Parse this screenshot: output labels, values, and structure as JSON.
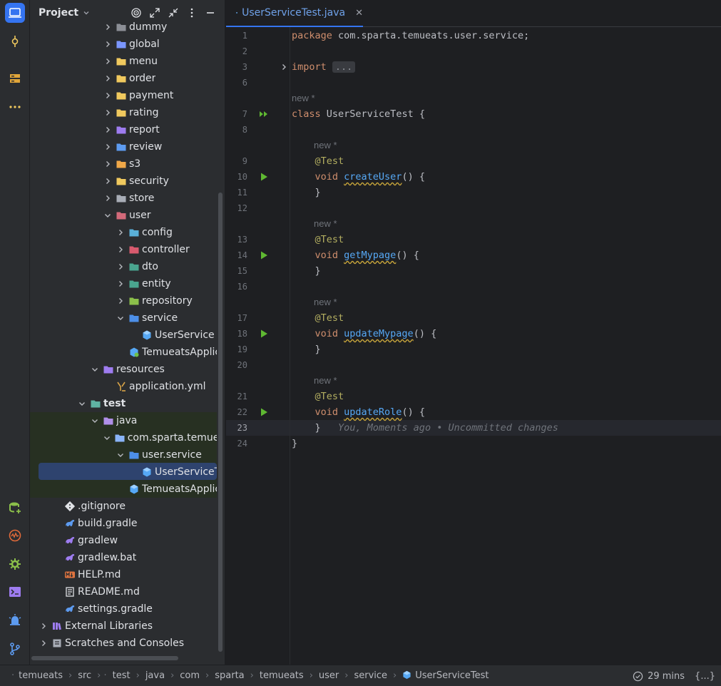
{
  "project_panel": {
    "title": "Project",
    "tree": [
      {
        "label": "dummy",
        "depth": 5,
        "expanded": false,
        "icon": "folder-package-icon",
        "color": "#8c8f96"
      },
      {
        "label": "global",
        "depth": 5,
        "expanded": false,
        "icon": "folder-global-icon",
        "color": "#7b96ff"
      },
      {
        "label": "menu",
        "depth": 5,
        "expanded": false,
        "icon": "folder-icon",
        "color": "#f0c95e"
      },
      {
        "label": "order",
        "depth": 5,
        "expanded": false,
        "icon": "folder-icon",
        "color": "#f0c95e"
      },
      {
        "label": "payment",
        "depth": 5,
        "expanded": false,
        "icon": "folder-icon",
        "color": "#f0c95e"
      },
      {
        "label": "rating",
        "depth": 5,
        "expanded": false,
        "icon": "folder-icon",
        "color": "#f0c95e"
      },
      {
        "label": "report",
        "depth": 5,
        "expanded": false,
        "icon": "folder-report-icon",
        "color": "#9e7cf0"
      },
      {
        "label": "review",
        "depth": 5,
        "expanded": false,
        "icon": "folder-review-icon",
        "color": "#5d9bf0"
      },
      {
        "label": "s3",
        "depth": 5,
        "expanded": false,
        "icon": "folder-cloud-icon",
        "color": "#f0a848"
      },
      {
        "label": "security",
        "depth": 5,
        "expanded": false,
        "icon": "folder-lock-icon",
        "color": "#f0c95e"
      },
      {
        "label": "store",
        "depth": 5,
        "expanded": false,
        "icon": "folder-store-icon",
        "color": "#a8adb6"
      },
      {
        "label": "user",
        "depth": 5,
        "expanded": true,
        "icon": "folder-user-icon",
        "color": "#d36a7a"
      },
      {
        "label": "config",
        "depth": 6,
        "expanded": false,
        "icon": "folder-config-icon",
        "color": "#5ab0d8"
      },
      {
        "label": "controller",
        "depth": 6,
        "expanded": false,
        "icon": "folder-controller-icon",
        "color": "#d85a6e"
      },
      {
        "label": "dto",
        "depth": 6,
        "expanded": false,
        "icon": "folder-dto-icon",
        "color": "#4aa58f"
      },
      {
        "label": "entity",
        "depth": 6,
        "expanded": false,
        "icon": "folder-entity-icon",
        "color": "#4aa58f"
      },
      {
        "label": "repository",
        "depth": 6,
        "expanded": false,
        "icon": "folder-repository-icon",
        "color": "#8bbf4a"
      },
      {
        "label": "service",
        "depth": 6,
        "expanded": true,
        "icon": "folder-service-icon",
        "color": "#4d8fe8"
      },
      {
        "label": "UserService",
        "depth": 8,
        "expanded": null,
        "icon": "java-class-icon",
        "color": "#56a8f5"
      },
      {
        "label": "TemueatsApplication",
        "depth": 7,
        "expanded": null,
        "icon": "spring-app-icon",
        "color": "#56a8f5"
      },
      {
        "label": "resources",
        "depth": 4,
        "expanded": true,
        "icon": "folder-resources-icon",
        "color": "#9e7cf0"
      },
      {
        "label": "application.yml",
        "depth": 6,
        "expanded": null,
        "icon": "yaml-file-icon",
        "color": "#d8a347"
      },
      {
        "label": "test",
        "depth": 3,
        "expanded": true,
        "icon": "folder-test-icon",
        "color": "#5fb3a3",
        "bold": true
      },
      {
        "label": "java",
        "depth": 4,
        "expanded": true,
        "icon": "folder-test-source-icon",
        "color": "#b08fe8"
      },
      {
        "label": "com.sparta.temueats",
        "depth": 5,
        "expanded": true,
        "icon": "folder-package-icon",
        "color": "#8ab4f8"
      },
      {
        "label": "user.service",
        "depth": 6,
        "expanded": true,
        "icon": "folder-service-icon",
        "color": "#4d8fe8"
      },
      {
        "label": "UserServiceTest",
        "depth": 8,
        "expanded": null,
        "icon": "java-class-icon",
        "color": "#56a8f5",
        "selected": true
      },
      {
        "label": "TemueatsApplicationTests",
        "depth": 7,
        "expanded": null,
        "icon": "java-class-icon",
        "color": "#56a8f5"
      },
      {
        "label": ".gitignore",
        "depth": 2,
        "expanded": null,
        "icon": "git-icon",
        "color": "#dfe1e5"
      },
      {
        "label": "build.gradle",
        "depth": 2,
        "expanded": null,
        "icon": "gradle-icon",
        "color": "#5d9bf0"
      },
      {
        "label": "gradlew",
        "depth": 2,
        "expanded": null,
        "icon": "gradle-icon",
        "color": "#9e7cf0"
      },
      {
        "label": "gradlew.bat",
        "depth": 2,
        "expanded": null,
        "icon": "gradle-icon",
        "color": "#9e7cf0"
      },
      {
        "label": "HELP.md",
        "depth": 2,
        "expanded": null,
        "icon": "markdown-icon",
        "color": "#e0743f"
      },
      {
        "label": "README.md",
        "depth": 2,
        "expanded": null,
        "icon": "readme-icon",
        "color": "#dfe1e5"
      },
      {
        "label": "settings.gradle",
        "depth": 2,
        "expanded": null,
        "icon": "gradle-icon",
        "color": "#5d9bf0"
      },
      {
        "label": "External Libraries",
        "depth": 0,
        "expanded": false,
        "icon": "library-icon",
        "color": "#9e7cf0"
      },
      {
        "label": "Scratches and Consoles",
        "depth": 0,
        "expanded": false,
        "icon": "scratches-icon",
        "color": "#a8adb6"
      }
    ]
  },
  "editor": {
    "tab_label": "UserServiceTest.java",
    "current_line": 23,
    "lines": [
      {
        "n": "1",
        "segments": [
          [
            "kw",
            "package "
          ],
          [
            "",
            "com.sparta.temueats.user.service;"
          ]
        ]
      },
      {
        "n": "2",
        "segments": []
      },
      {
        "n": "3",
        "segments": [
          [
            "kw",
            "import "
          ],
          [
            "fold",
            "..."
          ]
        ],
        "fold": true
      },
      {
        "n": "6",
        "segments": []
      },
      {
        "hint": "new *",
        "indent": 0
      },
      {
        "n": "7",
        "segments": [
          [
            "kw",
            "class "
          ],
          [
            "",
            "UserServiceTest "
          ],
          [
            "br",
            "{"
          ]
        ],
        "run": "double"
      },
      {
        "n": "8",
        "segments": []
      },
      {
        "hint": "new *",
        "indent": 1
      },
      {
        "n": "9",
        "segments": [
          [
            "ann",
            "    @Test"
          ]
        ]
      },
      {
        "n": "10",
        "segments": [
          [
            "kw",
            "    void "
          ],
          [
            "fn",
            "createUser"
          ],
          [
            "",
            "() "
          ],
          [
            "br",
            "{"
          ]
        ],
        "run": "single"
      },
      {
        "n": "11",
        "segments": [
          [
            "br",
            "    }"
          ]
        ]
      },
      {
        "n": "12",
        "segments": []
      },
      {
        "hint": "new *",
        "indent": 1
      },
      {
        "n": "13",
        "segments": [
          [
            "ann",
            "    @Test"
          ]
        ]
      },
      {
        "n": "14",
        "segments": [
          [
            "kw",
            "    void "
          ],
          [
            "fn",
            "getMypage"
          ],
          [
            "",
            "() "
          ],
          [
            "br",
            "{"
          ]
        ],
        "run": "single"
      },
      {
        "n": "15",
        "segments": [
          [
            "br",
            "    }"
          ]
        ]
      },
      {
        "n": "16",
        "segments": []
      },
      {
        "hint": "new *",
        "indent": 1
      },
      {
        "n": "17",
        "segments": [
          [
            "ann",
            "    @Test"
          ]
        ]
      },
      {
        "n": "18",
        "segments": [
          [
            "kw",
            "    void "
          ],
          [
            "fn",
            "updateMypage"
          ],
          [
            "",
            "() "
          ],
          [
            "br",
            "{"
          ]
        ],
        "run": "single"
      },
      {
        "n": "19",
        "segments": [
          [
            "br",
            "    }"
          ]
        ]
      },
      {
        "n": "20",
        "segments": []
      },
      {
        "hint": "new *",
        "indent": 1
      },
      {
        "n": "21",
        "segments": [
          [
            "ann",
            "    @Test"
          ]
        ]
      },
      {
        "n": "22",
        "segments": [
          [
            "kw",
            "    void "
          ],
          [
            "fn",
            "updateRole"
          ],
          [
            "",
            "() "
          ],
          [
            "br",
            "{"
          ]
        ],
        "run": "single"
      },
      {
        "n": "23",
        "segments": [
          [
            "br",
            "    }"
          ],
          [
            "blame",
            "   You, Moments ago • Uncommitted changes"
          ]
        ]
      },
      {
        "n": "24",
        "segments": [
          [
            "br",
            "}"
          ]
        ]
      }
    ]
  },
  "status_bar": {
    "breadcrumbs": [
      "temueats",
      "src",
      "test",
      "java",
      "com",
      "sparta",
      "temueats",
      "user",
      "service",
      "UserServiceTest"
    ],
    "time": "29 mins",
    "braces": "{...}"
  }
}
